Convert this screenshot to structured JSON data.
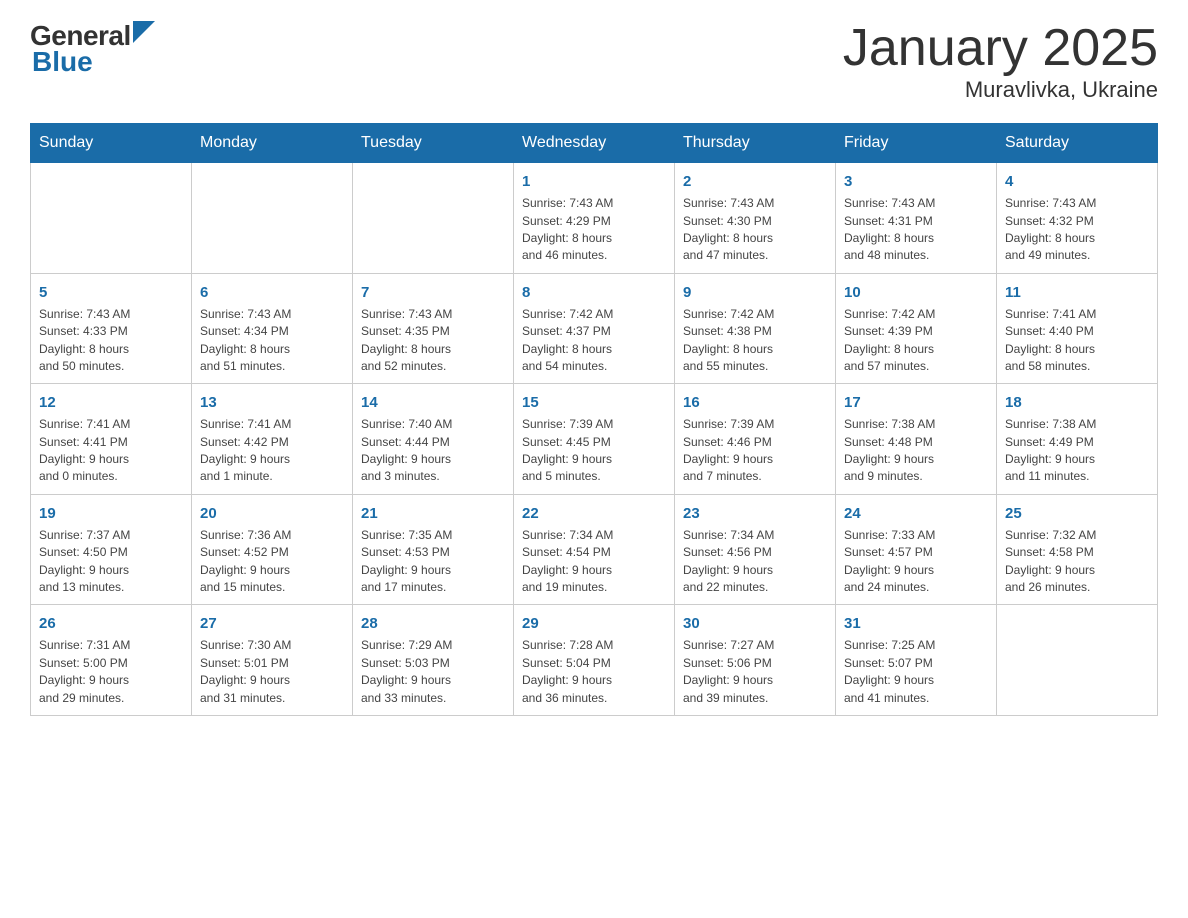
{
  "header": {
    "logo_general": "General",
    "logo_blue": "Blue",
    "title": "January 2025",
    "subtitle": "Muravlivka, Ukraine"
  },
  "days_of_week": [
    "Sunday",
    "Monday",
    "Tuesday",
    "Wednesday",
    "Thursday",
    "Friday",
    "Saturday"
  ],
  "weeks": [
    [
      {
        "day": "",
        "info": ""
      },
      {
        "day": "",
        "info": ""
      },
      {
        "day": "",
        "info": ""
      },
      {
        "day": "1",
        "info": "Sunrise: 7:43 AM\nSunset: 4:29 PM\nDaylight: 8 hours\nand 46 minutes."
      },
      {
        "day": "2",
        "info": "Sunrise: 7:43 AM\nSunset: 4:30 PM\nDaylight: 8 hours\nand 47 minutes."
      },
      {
        "day": "3",
        "info": "Sunrise: 7:43 AM\nSunset: 4:31 PM\nDaylight: 8 hours\nand 48 minutes."
      },
      {
        "day": "4",
        "info": "Sunrise: 7:43 AM\nSunset: 4:32 PM\nDaylight: 8 hours\nand 49 minutes."
      }
    ],
    [
      {
        "day": "5",
        "info": "Sunrise: 7:43 AM\nSunset: 4:33 PM\nDaylight: 8 hours\nand 50 minutes."
      },
      {
        "day": "6",
        "info": "Sunrise: 7:43 AM\nSunset: 4:34 PM\nDaylight: 8 hours\nand 51 minutes."
      },
      {
        "day": "7",
        "info": "Sunrise: 7:43 AM\nSunset: 4:35 PM\nDaylight: 8 hours\nand 52 minutes."
      },
      {
        "day": "8",
        "info": "Sunrise: 7:42 AM\nSunset: 4:37 PM\nDaylight: 8 hours\nand 54 minutes."
      },
      {
        "day": "9",
        "info": "Sunrise: 7:42 AM\nSunset: 4:38 PM\nDaylight: 8 hours\nand 55 minutes."
      },
      {
        "day": "10",
        "info": "Sunrise: 7:42 AM\nSunset: 4:39 PM\nDaylight: 8 hours\nand 57 minutes."
      },
      {
        "day": "11",
        "info": "Sunrise: 7:41 AM\nSunset: 4:40 PM\nDaylight: 8 hours\nand 58 minutes."
      }
    ],
    [
      {
        "day": "12",
        "info": "Sunrise: 7:41 AM\nSunset: 4:41 PM\nDaylight: 9 hours\nand 0 minutes."
      },
      {
        "day": "13",
        "info": "Sunrise: 7:41 AM\nSunset: 4:42 PM\nDaylight: 9 hours\nand 1 minute."
      },
      {
        "day": "14",
        "info": "Sunrise: 7:40 AM\nSunset: 4:44 PM\nDaylight: 9 hours\nand 3 minutes."
      },
      {
        "day": "15",
        "info": "Sunrise: 7:39 AM\nSunset: 4:45 PM\nDaylight: 9 hours\nand 5 minutes."
      },
      {
        "day": "16",
        "info": "Sunrise: 7:39 AM\nSunset: 4:46 PM\nDaylight: 9 hours\nand 7 minutes."
      },
      {
        "day": "17",
        "info": "Sunrise: 7:38 AM\nSunset: 4:48 PM\nDaylight: 9 hours\nand 9 minutes."
      },
      {
        "day": "18",
        "info": "Sunrise: 7:38 AM\nSunset: 4:49 PM\nDaylight: 9 hours\nand 11 minutes."
      }
    ],
    [
      {
        "day": "19",
        "info": "Sunrise: 7:37 AM\nSunset: 4:50 PM\nDaylight: 9 hours\nand 13 minutes."
      },
      {
        "day": "20",
        "info": "Sunrise: 7:36 AM\nSunset: 4:52 PM\nDaylight: 9 hours\nand 15 minutes."
      },
      {
        "day": "21",
        "info": "Sunrise: 7:35 AM\nSunset: 4:53 PM\nDaylight: 9 hours\nand 17 minutes."
      },
      {
        "day": "22",
        "info": "Sunrise: 7:34 AM\nSunset: 4:54 PM\nDaylight: 9 hours\nand 19 minutes."
      },
      {
        "day": "23",
        "info": "Sunrise: 7:34 AM\nSunset: 4:56 PM\nDaylight: 9 hours\nand 22 minutes."
      },
      {
        "day": "24",
        "info": "Sunrise: 7:33 AM\nSunset: 4:57 PM\nDaylight: 9 hours\nand 24 minutes."
      },
      {
        "day": "25",
        "info": "Sunrise: 7:32 AM\nSunset: 4:58 PM\nDaylight: 9 hours\nand 26 minutes."
      }
    ],
    [
      {
        "day": "26",
        "info": "Sunrise: 7:31 AM\nSunset: 5:00 PM\nDaylight: 9 hours\nand 29 minutes."
      },
      {
        "day": "27",
        "info": "Sunrise: 7:30 AM\nSunset: 5:01 PM\nDaylight: 9 hours\nand 31 minutes."
      },
      {
        "day": "28",
        "info": "Sunrise: 7:29 AM\nSunset: 5:03 PM\nDaylight: 9 hours\nand 33 minutes."
      },
      {
        "day": "29",
        "info": "Sunrise: 7:28 AM\nSunset: 5:04 PM\nDaylight: 9 hours\nand 36 minutes."
      },
      {
        "day": "30",
        "info": "Sunrise: 7:27 AM\nSunset: 5:06 PM\nDaylight: 9 hours\nand 39 minutes."
      },
      {
        "day": "31",
        "info": "Sunrise: 7:25 AM\nSunset: 5:07 PM\nDaylight: 9 hours\nand 41 minutes."
      },
      {
        "day": "",
        "info": ""
      }
    ]
  ]
}
